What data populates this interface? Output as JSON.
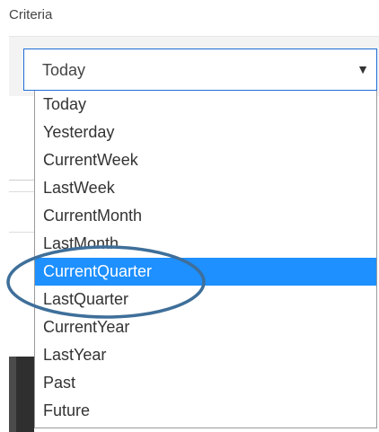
{
  "criteria": {
    "label": "Criteria",
    "selected_value": "Today",
    "arrow": "▼",
    "options": [
      {
        "label": "Today",
        "highlighted": false
      },
      {
        "label": "Yesterday",
        "highlighted": false
      },
      {
        "label": "CurrentWeek",
        "highlighted": false
      },
      {
        "label": "LastWeek",
        "highlighted": false
      },
      {
        "label": "CurrentMonth",
        "highlighted": false
      },
      {
        "label": "LastMonth",
        "highlighted": false
      },
      {
        "label": "CurrentQuarter",
        "highlighted": true
      },
      {
        "label": "LastQuarter",
        "highlighted": false
      },
      {
        "label": "CurrentYear",
        "highlighted": false
      },
      {
        "label": "LastYear",
        "highlighted": false
      },
      {
        "label": "Past",
        "highlighted": false
      },
      {
        "label": "Future",
        "highlighted": false
      }
    ]
  },
  "colors": {
    "highlight": "#1e90ff",
    "select_border": "#1e6ed6",
    "annotation": "#3f6f9a"
  }
}
